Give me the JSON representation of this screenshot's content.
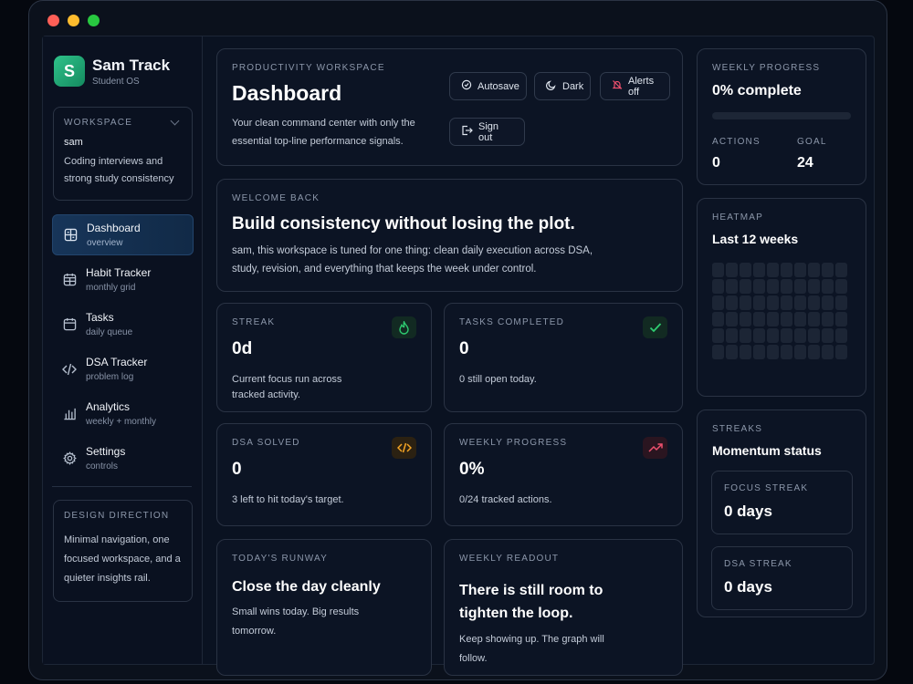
{
  "window": {
    "controls": [
      "close",
      "minimize",
      "maximize"
    ]
  },
  "brand": {
    "initial": "S",
    "name": "Sam Track",
    "subtitle": "Student OS"
  },
  "workspace": {
    "label": "WORKSPACE",
    "user": "sam",
    "description": "Coding interviews and strong study consistency"
  },
  "nav": [
    {
      "label": "Dashboard",
      "sub": "overview",
      "icon": "dashboard-icon",
      "active": true
    },
    {
      "label": "Habit Tracker",
      "sub": "monthly grid",
      "icon": "calendar-grid-icon"
    },
    {
      "label": "Tasks",
      "sub": "daily queue",
      "icon": "calendar-icon"
    },
    {
      "label": "DSA Tracker",
      "sub": "problem log",
      "icon": "code-icon"
    },
    {
      "label": "Analytics",
      "sub": "weekly + monthly",
      "icon": "bar-chart-icon"
    },
    {
      "label": "Settings",
      "sub": "controls",
      "icon": "gear-icon"
    }
  ],
  "design_direction": {
    "label": "DESIGN DIRECTION",
    "text": "Minimal navigation, one focused workspace, and a quieter insights rail."
  },
  "header": {
    "eyebrow": "PRODUCTIVITY WORKSPACE",
    "title": "Dashboard",
    "description": "Your clean command center with only the essential top-line performance signals.",
    "buttons": {
      "autosave": "Autosave",
      "dark": "Dark",
      "alerts": "Alerts off",
      "signout": "Sign out"
    }
  },
  "welcome": {
    "eyebrow": "WELCOME BACK",
    "title": "Build consistency without losing the plot.",
    "text": "sam, this workspace is tuned for one thing: clean daily execution across DSA, study, revision, and everything that keeps the week under control."
  },
  "metrics": {
    "streak": {
      "label": "STREAK",
      "value": "0d",
      "desc": "Current focus run across tracked activity.",
      "icon": "flame-icon",
      "color": "#2ecc71"
    },
    "tasks": {
      "label": "TASKS COMPLETED",
      "value": "0",
      "desc": "0 still open today.",
      "icon": "check-icon",
      "color": "#2ecc71"
    },
    "dsa": {
      "label": "DSA SOLVED",
      "value": "0",
      "desc": "3 left to hit today's target.",
      "icon": "code-icon",
      "color": "#f5a524"
    },
    "weekly": {
      "label": "WEEKLY PROGRESS",
      "value": "0%",
      "desc": "0/24 tracked actions.",
      "icon": "trend-up-icon",
      "color": "#f0506e"
    }
  },
  "runway": {
    "eyebrow": "TODAY'S RUNWAY",
    "title": "Close the day cleanly",
    "text": "Small wins today. Big results tomorrow."
  },
  "readout": {
    "eyebrow": "WEEKLY READOUT",
    "title": "There is still room to tighten the loop.",
    "text": "Keep showing up. The graph will follow."
  },
  "weekly_progress": {
    "label": "WEEKLY PROGRESS",
    "title": "0% complete",
    "progress": 0,
    "actions_label": "ACTIONS",
    "actions_value": "0",
    "goal_label": "GOAL",
    "goal_value": "24"
  },
  "heatmap": {
    "label": "HEATMAP",
    "title": "Last 12 weeks"
  },
  "streaks": {
    "label": "STREAKS",
    "title": "Momentum status",
    "focus_label": "FOCUS STREAK",
    "focus_value": "0 days",
    "dsa_label": "DSA STREAK",
    "dsa_value": "0 days"
  },
  "colors": {
    "accent": "#2fc28a",
    "active_nav": "#173559",
    "background": "#0a1221"
  }
}
